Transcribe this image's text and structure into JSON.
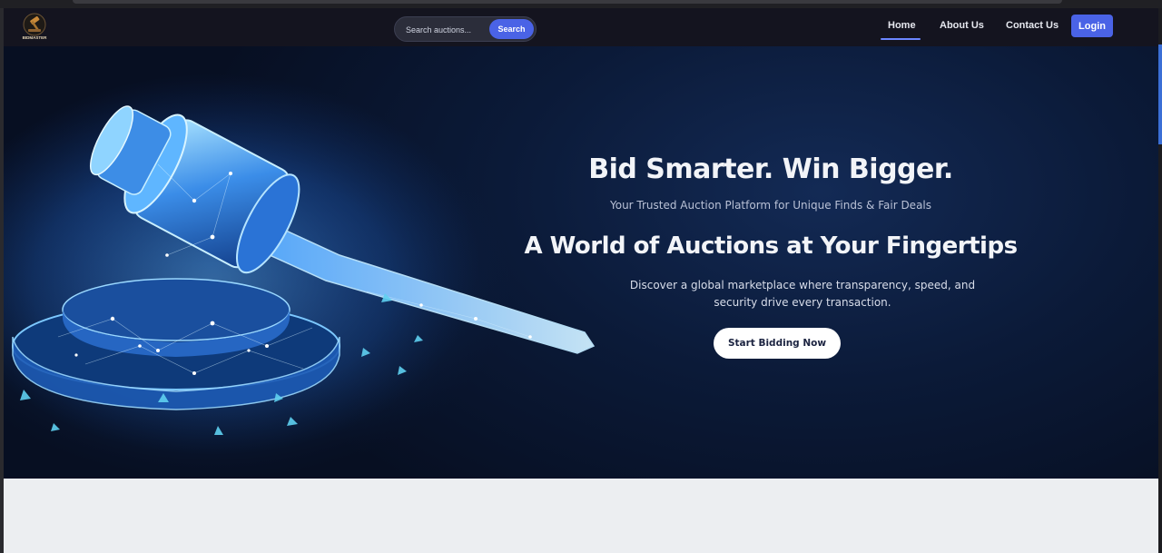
{
  "colors": {
    "nav_background": "#14141f",
    "accent": "#4a63e6",
    "hero_background": "#08112a",
    "lower_background": "#eceef1"
  },
  "nav": {
    "logo": {
      "icon": "gavel-logo-icon",
      "text": "BIDMASTER"
    },
    "search": {
      "placeholder": "Search auctions...",
      "button_label": "Search"
    },
    "links": {
      "home": "Home",
      "about": "About Us",
      "contact": "Contact Us"
    },
    "active_link": "Home",
    "login_label": "Login"
  },
  "hero": {
    "image_icon": "glowing-gavel-illustration",
    "headline": "Bid Smarter. Win Bigger.",
    "tagline": "Your Trusted Auction Platform for Unique Finds & Fair Deals",
    "subheadline": "A World of Auctions at Your Fingertips",
    "description": "Discover a global marketplace where transparency, speed, and security drive every transaction.",
    "cta_label": "Start Bidding Now"
  }
}
